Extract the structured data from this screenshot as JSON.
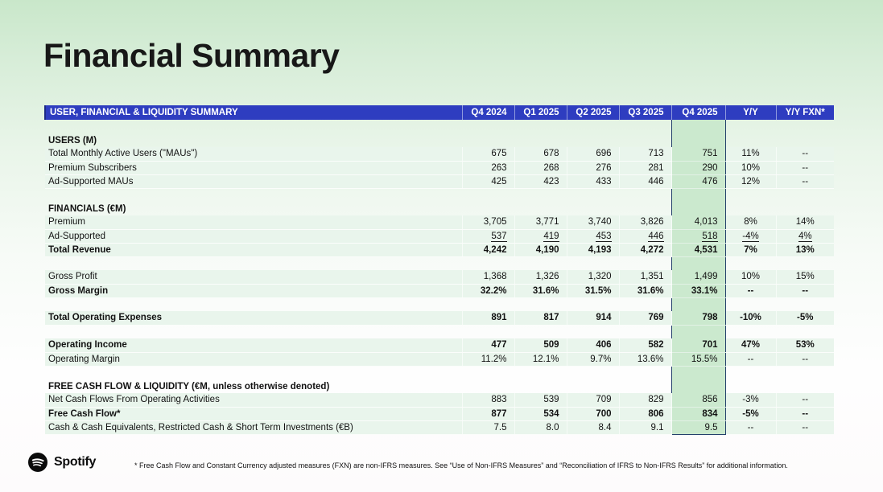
{
  "page": {
    "title": "Financial Summary"
  },
  "table": {
    "header_label": "USER, FINANCIAL & LIQUIDITY SUMMARY",
    "columns": [
      "Q4 2024",
      "Q1 2025",
      "Q2 2025",
      "Q3 2025",
      "Q4 2025",
      "Y/Y",
      "Y/Y FXN*"
    ],
    "highlight_column": "Q4 2025",
    "rows": [
      {
        "type": "spacer"
      },
      {
        "type": "section",
        "label": "USERS (M)"
      },
      {
        "type": "data",
        "label": "Total Monthly Active Users (\"MAUs\")",
        "values": [
          "675",
          "678",
          "696",
          "713",
          "751",
          "11%",
          "--"
        ]
      },
      {
        "type": "data",
        "label": "Premium Subscribers",
        "values": [
          "263",
          "268",
          "276",
          "281",
          "290",
          "10%",
          "--"
        ]
      },
      {
        "type": "data",
        "label": "Ad-Supported MAUs",
        "values": [
          "425",
          "423",
          "433",
          "446",
          "476",
          "12%",
          "--"
        ]
      },
      {
        "type": "spacer"
      },
      {
        "type": "section",
        "label": "FINANCIALS (€M)"
      },
      {
        "type": "data",
        "label": "Premium",
        "values": [
          "3,705",
          "3,771",
          "3,740",
          "3,826",
          "4,013",
          "8%",
          "14%"
        ]
      },
      {
        "type": "data",
        "label": "Ad-Supported",
        "underline": true,
        "values": [
          "537",
          "419",
          "453",
          "446",
          "518",
          "-4%",
          "4%"
        ]
      },
      {
        "type": "data",
        "label": "Total Revenue",
        "bold": true,
        "values": [
          "4,242",
          "4,190",
          "4,193",
          "4,272",
          "4,531",
          "7%",
          "13%"
        ]
      },
      {
        "type": "spacer"
      },
      {
        "type": "data",
        "label": "Gross Profit",
        "values": [
          "1,368",
          "1,326",
          "1,320",
          "1,351",
          "1,499",
          "10%",
          "15%"
        ]
      },
      {
        "type": "data",
        "label": "Gross Margin",
        "bold": true,
        "values": [
          "32.2%",
          "31.6%",
          "31.5%",
          "31.6%",
          "33.1%",
          "--",
          "--"
        ]
      },
      {
        "type": "spacer"
      },
      {
        "type": "data",
        "label": "Total Operating Expenses",
        "bold": true,
        "values": [
          "891",
          "817",
          "914",
          "769",
          "798",
          "-10%",
          "-5%"
        ]
      },
      {
        "type": "spacer"
      },
      {
        "type": "data",
        "label": "Operating Income",
        "bold": true,
        "values": [
          "477",
          "509",
          "406",
          "582",
          "701",
          "47%",
          "53%"
        ]
      },
      {
        "type": "data",
        "label": "Operating Margin",
        "values": [
          "11.2%",
          "12.1%",
          "9.7%",
          "13.6%",
          "15.5%",
          "--",
          "--"
        ]
      },
      {
        "type": "spacer"
      },
      {
        "type": "section",
        "label": "FREE CASH FLOW & LIQUIDITY (€M, unless otherwise denoted)"
      },
      {
        "type": "data",
        "label": "Net Cash Flows From Operating Activities",
        "values": [
          "883",
          "539",
          "709",
          "829",
          "856",
          "-3%",
          "--"
        ]
      },
      {
        "type": "data",
        "label": "Free Cash Flow*",
        "bold": true,
        "values": [
          "877",
          "534",
          "700",
          "806",
          "834",
          "-5%",
          "--"
        ]
      },
      {
        "type": "data",
        "label": "Cash & Cash Equivalents, Restricted Cash & Short Term Investments (€B)",
        "values": [
          "7.5",
          "8.0",
          "8.4",
          "9.1",
          "9.5",
          "--",
          "--"
        ]
      }
    ]
  },
  "footer": {
    "brand": "Spotify",
    "footnote": "* Free Cash Flow and Constant Currency adjusted measures (FXN) are non-IFRS measures. See “Use of Non-IFRS Measures” and “Reconciliation of IFRS to Non-IFRS Results” for additional information."
  },
  "colors": {
    "header_bar": "#2e3dc0",
    "highlight_fill": "#cbe9ce",
    "highlight_border": "#24406b",
    "row_fill": "#e9f5ec",
    "background_top": "#c9e7ca"
  }
}
